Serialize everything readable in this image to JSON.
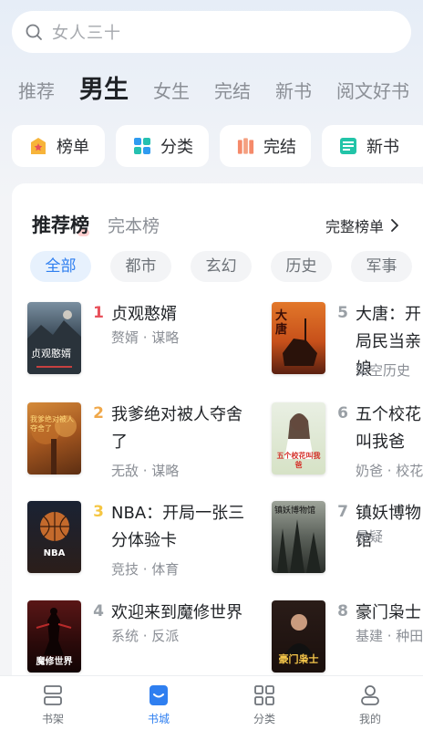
{
  "search": {
    "placeholder": "女人三十"
  },
  "channels": [
    "推荐",
    "男生",
    "女生",
    "完结",
    "新书",
    "阅文好书"
  ],
  "active_channel": "男生",
  "quick_entries": [
    {
      "label": "榜单",
      "icon": "rank-badge-icon"
    },
    {
      "label": "分类",
      "icon": "category-grid-icon"
    },
    {
      "label": "完结",
      "icon": "finished-books-icon"
    },
    {
      "label": "新书",
      "icon": "new-book-icon"
    }
  ],
  "ranking": {
    "tabs": [
      "推荐榜",
      "完本榜"
    ],
    "full_list": "完整榜单",
    "categories": [
      "全部",
      "都市",
      "玄幻",
      "历史",
      "军事"
    ],
    "active_category": "全部",
    "books": [
      {
        "rank": "1",
        "title": "贞观憨婿",
        "tags": "赘婿 · 谋略",
        "cover_title": "贞观憨婿"
      },
      {
        "rank": "2",
        "title": "我爹绝对被人夺舍了",
        "tags": "无敌 · 谋略",
        "cover_title": "我爹绝对被人夺舍了"
      },
      {
        "rank": "3",
        "title": "NBA：开局一张三分体验卡",
        "tags": "竞技 · 体育",
        "cover_title": "NBA"
      },
      {
        "rank": "4",
        "title": "欢迎来到魔修世界",
        "tags": "系统 · 反派",
        "cover_title": "魔修世界"
      },
      {
        "rank": "5",
        "title": "大唐：开局民当亲娘",
        "tags": "架空历史",
        "cover_title": "大唐"
      },
      {
        "rank": "6",
        "title": "五个校花叫我爸",
        "tags": "奶爸 · 校花",
        "cover_title": "五个校花叫我爸"
      },
      {
        "rank": "7",
        "title": "镇妖博物馆",
        "tags": "悬疑",
        "cover_title": "镇妖博物馆"
      },
      {
        "rank": "8",
        "title": "豪门枭士",
        "tags": "基建 · 种田",
        "cover_title": "豪门枭士"
      }
    ]
  },
  "bottom_nav": [
    {
      "label": "书架",
      "icon": "bookshelf-icon"
    },
    {
      "label": "书城",
      "icon": "bookstore-icon"
    },
    {
      "label": "分类",
      "icon": "category-icon"
    },
    {
      "label": "我的",
      "icon": "profile-icon"
    }
  ],
  "active_nav": "书城",
  "colors": {
    "accent": "#2f7ff0",
    "rank1": "#e8515b",
    "rank2": "#f0a84a",
    "rank3": "#f5c642",
    "rank_other": "#9aa0a6"
  }
}
